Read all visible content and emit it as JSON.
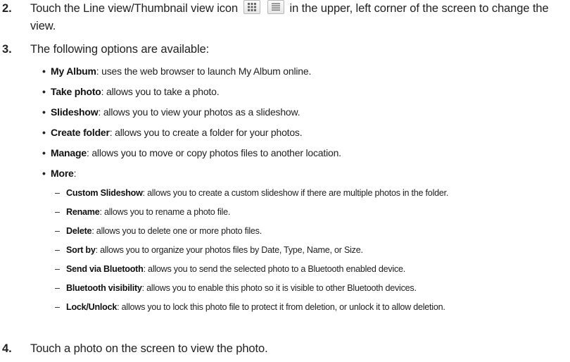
{
  "steps": [
    {
      "num": "2.",
      "line1_before": "Touch the Line view/Thumbnail view icon",
      "line1_after": "in the upper, left corner of the screen to change the",
      "line2": "view.",
      "icons": [
        "thumbnail-grid-icon",
        "line-list-icon"
      ]
    },
    {
      "num": "3.",
      "text": "The following options are available:"
    },
    {
      "num": "4.",
      "text": "Touch a photo on the screen to view the photo."
    }
  ],
  "options": [
    {
      "term": "My Album",
      "desc": ": uses the web browser to launch My Album online."
    },
    {
      "term": "Take photo",
      "desc": ": allows you to take a photo."
    },
    {
      "term": "Slideshow",
      "desc": ": allows you to view your photos as a slideshow."
    },
    {
      "term": "Create folder",
      "desc": ": allows you to create a folder for your photos."
    },
    {
      "term": "Manage",
      "desc": ": allows you to move or copy photos files to another location."
    },
    {
      "term": "More",
      "desc": ":"
    }
  ],
  "more_options": [
    {
      "term": "Custom Slideshow",
      "desc": ": allows you to create a custom slideshow if there are multiple photos in the folder."
    },
    {
      "term": "Rename",
      "desc": ": allows you to rename a photo file."
    },
    {
      "term": "Delete",
      "desc": ": allows you to delete one or more photo files."
    },
    {
      "term": "Sort by",
      "desc": ": allows you to organize your photos files by Date, Type, Name, or Size."
    },
    {
      "term": "Send via Bluetooth",
      "desc": ": allows you to send the selected photo to a Bluetooth enabled device."
    },
    {
      "term": "Bluetooth visibility",
      "desc": ": allows you to enable this photo so it is visible to other Bluetooth devices."
    },
    {
      "term": "Lock/Unlock",
      "desc": ": allows you to lock this photo file to protect it from deletion, or unlock it to allow deletion."
    }
  ]
}
